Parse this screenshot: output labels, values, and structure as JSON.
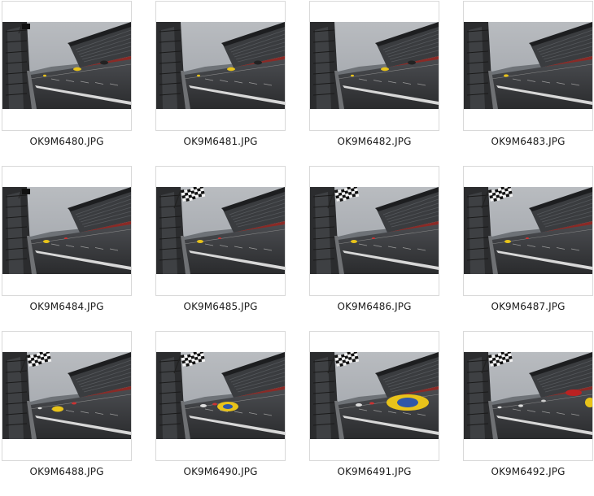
{
  "files": [
    {
      "name": "OK9M6480.JPG",
      "flag": "small",
      "cars": "far"
    },
    {
      "name": "OK9M6481.JPG",
      "flag": "none",
      "cars": "far"
    },
    {
      "name": "OK9M6482.JPG",
      "flag": "none",
      "cars": "far"
    },
    {
      "name": "OK9M6483.JPG",
      "flag": "none",
      "cars": "one-far"
    },
    {
      "name": "OK9M6484.JPG",
      "flag": "small",
      "cars": "one-mid"
    },
    {
      "name": "OK9M6485.JPG",
      "flag": "wave",
      "cars": "one-mid"
    },
    {
      "name": "OK9M6486.JPG",
      "flag": "wave",
      "cars": "one-mid"
    },
    {
      "name": "OK9M6487.JPG",
      "flag": "wave",
      "cars": "one-mid"
    },
    {
      "name": "OK9M6488.JPG",
      "flag": "wave",
      "cars": "near"
    },
    {
      "name": "OK9M6490.JPG",
      "flag": "wave",
      "cars": "closer"
    },
    {
      "name": "OK9M6491.JPG",
      "flag": "wave",
      "cars": "closest"
    },
    {
      "name": "OK9M6492.JPG",
      "flag": "wave",
      "cars": "pack"
    }
  ],
  "colors": {
    "border": "#d9d9d9",
    "caption": "#1a1a1a",
    "background": "#ffffff",
    "car_yellow": "#e8c31a",
    "car_blue": "#2f57a8"
  }
}
